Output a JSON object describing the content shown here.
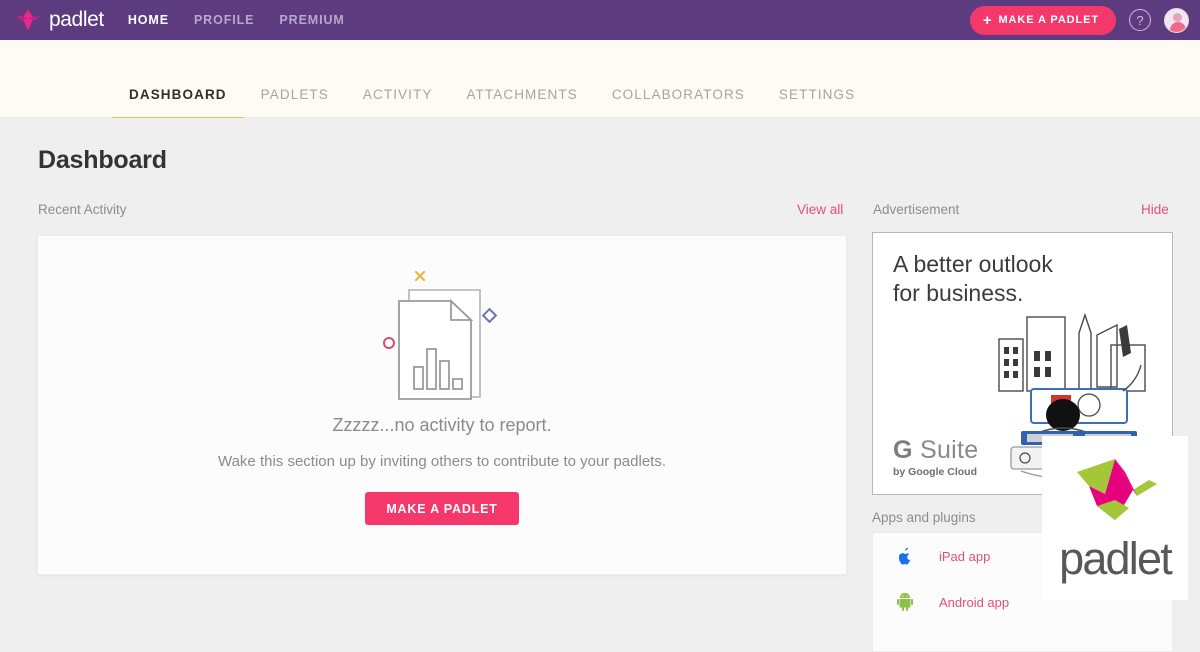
{
  "topbar": {
    "brand": "padlet",
    "brand_icon": "padlet-bird-icon",
    "nav": [
      {
        "label": "HOME",
        "active": true
      },
      {
        "label": "PROFILE",
        "active": false
      },
      {
        "label": "PREMIUM",
        "active": false
      }
    ],
    "make_padlet_label": "MAKE A PADLET",
    "plus_icon": "plus-icon",
    "help_icon": "question-mark-icon",
    "avatar_icon": "user-avatar",
    "background_color": "#5c3c7e",
    "accent_color": "#f5386a"
  },
  "subnav": {
    "tabs": [
      {
        "label": "DASHBOARD",
        "active": true
      },
      {
        "label": "PADLETS",
        "active": false
      },
      {
        "label": "ACTIVITY",
        "active": false
      },
      {
        "label": "ATTACHMENTS",
        "active": false
      },
      {
        "label": "COLLABORATORS",
        "active": false
      },
      {
        "label": "SETTINGS",
        "active": false
      }
    ],
    "active_underline_color": "#eec14a",
    "background_color": "#fdfbf4"
  },
  "main": {
    "page_title": "Dashboard",
    "recent_activity": {
      "label": "Recent Activity",
      "view_all_label": "View all",
      "empty_title": "Zzzzz...no activity to report.",
      "empty_subtitle": "Wake this section up by inviting others to contribute to your padlets.",
      "cta_label": "MAKE A PADLET",
      "illustration": "document-bar-chart-illustration"
    },
    "advertisement": {
      "label": "Advertisement",
      "hide_label": "Hide",
      "headline_line1": "A better outlook",
      "headline_line2": "for business.",
      "brand_g": "G",
      "brand_name": "Suite",
      "brand_tagline": "by Google Cloud",
      "illustration": "city-skyline-desk-illustration"
    },
    "apps": {
      "label": "Apps and plugins",
      "items": [
        {
          "label": "iPad app",
          "icon": "apple-icon",
          "icon_color": "#1a73e8"
        },
        {
          "label": "Android app",
          "icon": "android-icon",
          "icon_color": "#8bc34a"
        }
      ]
    }
  },
  "logo_overlay": {
    "wordmark": "padlet",
    "icon": "padlet-origami-crane-icon",
    "green": "#a4c639",
    "magenta": "#e6007e"
  }
}
